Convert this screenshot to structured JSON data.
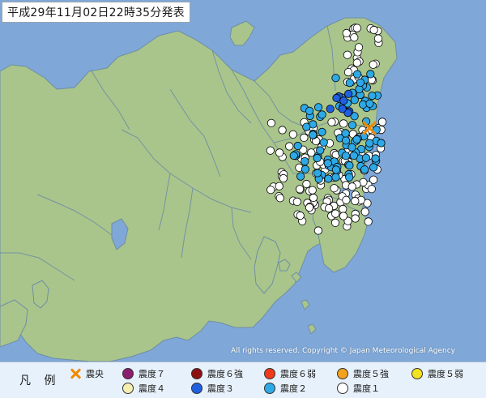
{
  "title": "平成29年11月02日22時35分発表",
  "copyright": "All rights reserved. Copyright © Japan Meteorological Agency",
  "legend": {
    "title": "凡 例",
    "items": [
      {
        "name": "epicenter",
        "label": "震央",
        "symbol": "x",
        "color": "#f08a00"
      },
      {
        "name": "shindo-7",
        "label": "震度７",
        "color": "#8b1e6e"
      },
      {
        "name": "shindo-6-strong",
        "label": "震度６強",
        "color": "#8f1010"
      },
      {
        "name": "shindo-6-weak",
        "label": "震度６弱",
        "color": "#f03a1a"
      },
      {
        "name": "shindo-5-strong",
        "label": "震度５強",
        "color": "#f4a21b"
      },
      {
        "name": "shindo-5-weak",
        "label": "震度５弱",
        "color": "#f3e21f"
      },
      {
        "name": "shindo-4",
        "label": "震度４",
        "color": "#f4efb0"
      },
      {
        "name": "shindo-3",
        "label": "震度３",
        "color": "#1f5fe0"
      },
      {
        "name": "shindo-2",
        "label": "震度２",
        "color": "#2fa9e6"
      },
      {
        "name": "shindo-1",
        "label": "震度１",
        "color": "#ffffff"
      }
    ]
  },
  "map": {
    "sea_color": "#7fa8d8",
    "land_color": "#a9c58b",
    "border_color": "#6f8ea4",
    "epicenter": {
      "color": "#f08a00"
    },
    "stations": {
      "shindo_1": 160,
      "shindo_2": 95,
      "shindo_3": 8
    }
  }
}
